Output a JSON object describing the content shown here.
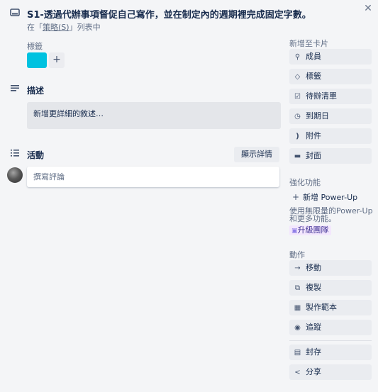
{
  "card": {
    "title": "S1-透過代辦事項督促自己寫作，並在制定內的週期裡完成固定字數。",
    "subtitle_prefix": "在「",
    "list_name": "策略(S)",
    "subtitle_suffix": "」列表中",
    "close_icon": "close-icon"
  },
  "labels": {
    "heading": "標籤",
    "chips": [
      {
        "color": "#00c2e0"
      }
    ],
    "add_label": "+"
  },
  "description": {
    "title": "描述",
    "placeholder": "新增更詳細的敘述…"
  },
  "activity": {
    "title": "活動",
    "show_details_label": "顯示詳情",
    "comment_placeholder": "撰寫評論"
  },
  "sidebar": {
    "add_to_card_heading": "新增至卡片",
    "add_to_card": [
      {
        "label": "成員",
        "icon": "person-icon"
      },
      {
        "label": "標籤",
        "icon": "tag-icon"
      },
      {
        "label": "待辦清單",
        "icon": "checklist-icon"
      },
      {
        "label": "到期日",
        "icon": "clock-icon"
      },
      {
        "label": "附件",
        "icon": "paperclip-icon"
      },
      {
        "label": "封面",
        "icon": "cover-icon"
      }
    ],
    "powerups_heading": "強化功能",
    "powerups_add": "新增 Power-Up",
    "powerups_desc": "使用無限量的Power-Up 和更多功能。",
    "upgrade_label": "升級團隊",
    "actions_heading": "動作",
    "actions": [
      {
        "label": "移動",
        "icon": "arrow-right-icon"
      },
      {
        "label": "複製",
        "icon": "copy-icon"
      },
      {
        "label": "製作範本",
        "icon": "template-icon"
      },
      {
        "label": "追蹤",
        "icon": "eye-icon"
      }
    ],
    "more_actions": [
      {
        "label": "封存",
        "icon": "archive-icon"
      },
      {
        "label": "分享",
        "icon": "share-icon"
      }
    ]
  },
  "colors": {
    "label_cyan": "#00c2e0",
    "button_bg": "#eaecf0",
    "text": "#172b4d",
    "muted": "#5e6c84"
  }
}
